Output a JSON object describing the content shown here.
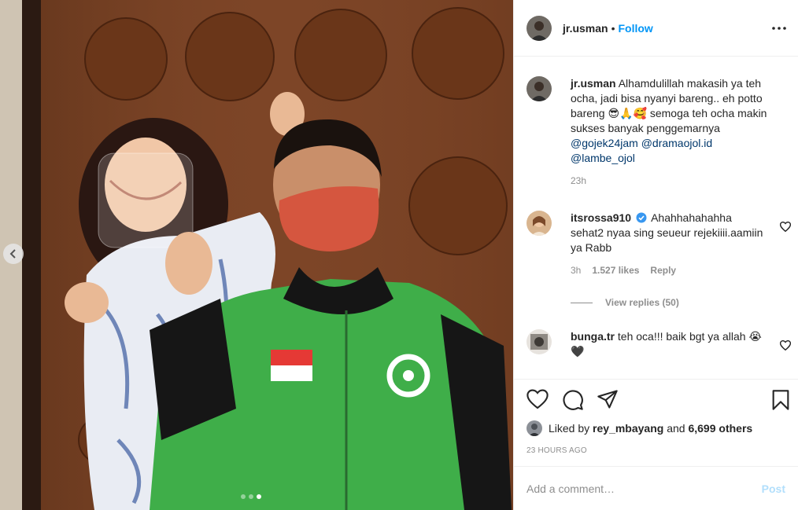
{
  "post": {
    "author": "jr.usman",
    "follow_label": "Follow",
    "separator": "•",
    "carousel_dots": 3,
    "active_dot": 2
  },
  "caption": {
    "username": "jr.usman",
    "text_before": "Alhamdulillah makasih ya teh ocha, jadi bisa nyanyi bareng.. eh potto bareng 😎🙏🥰 semoga teh ocha makin sukses banyak penggemarnya ",
    "mention1": "@gojek24jam",
    "mention2": "@dramaojol.id",
    "mention3": "@lambe_ojol",
    "time": "23h"
  },
  "comments": [
    {
      "username": "itsrossa910",
      "verified": true,
      "text": "Ahahhahahahha sehat2 nyaa sing seueur rejekiiii.aamiin ya Rabb",
      "time": "3h",
      "likes": "1.527 likes",
      "reply_label": "Reply",
      "view_replies": "View replies (50)"
    },
    {
      "username": "bunga.tr",
      "verified": false,
      "text": "teh oca!!! baik bgt ya allah 😭🖤"
    }
  ],
  "likes": {
    "prefix": "Liked by",
    "user": "rey_mbayang",
    "conj": "and",
    "others": "6,699 others"
  },
  "timestamp": "23 HOURS AGO",
  "add_comment": {
    "placeholder": "Add a comment…",
    "post_label": "Post"
  },
  "colors": {
    "accent": "#0095f6",
    "mention": "#00376b",
    "muted": "#8e8e8e",
    "jacket": "#3fae49"
  },
  "icons": [
    "more-options-icon",
    "heart-icon",
    "comment-icon",
    "share-icon",
    "save-icon",
    "verified-icon",
    "chevron-left-icon"
  ]
}
